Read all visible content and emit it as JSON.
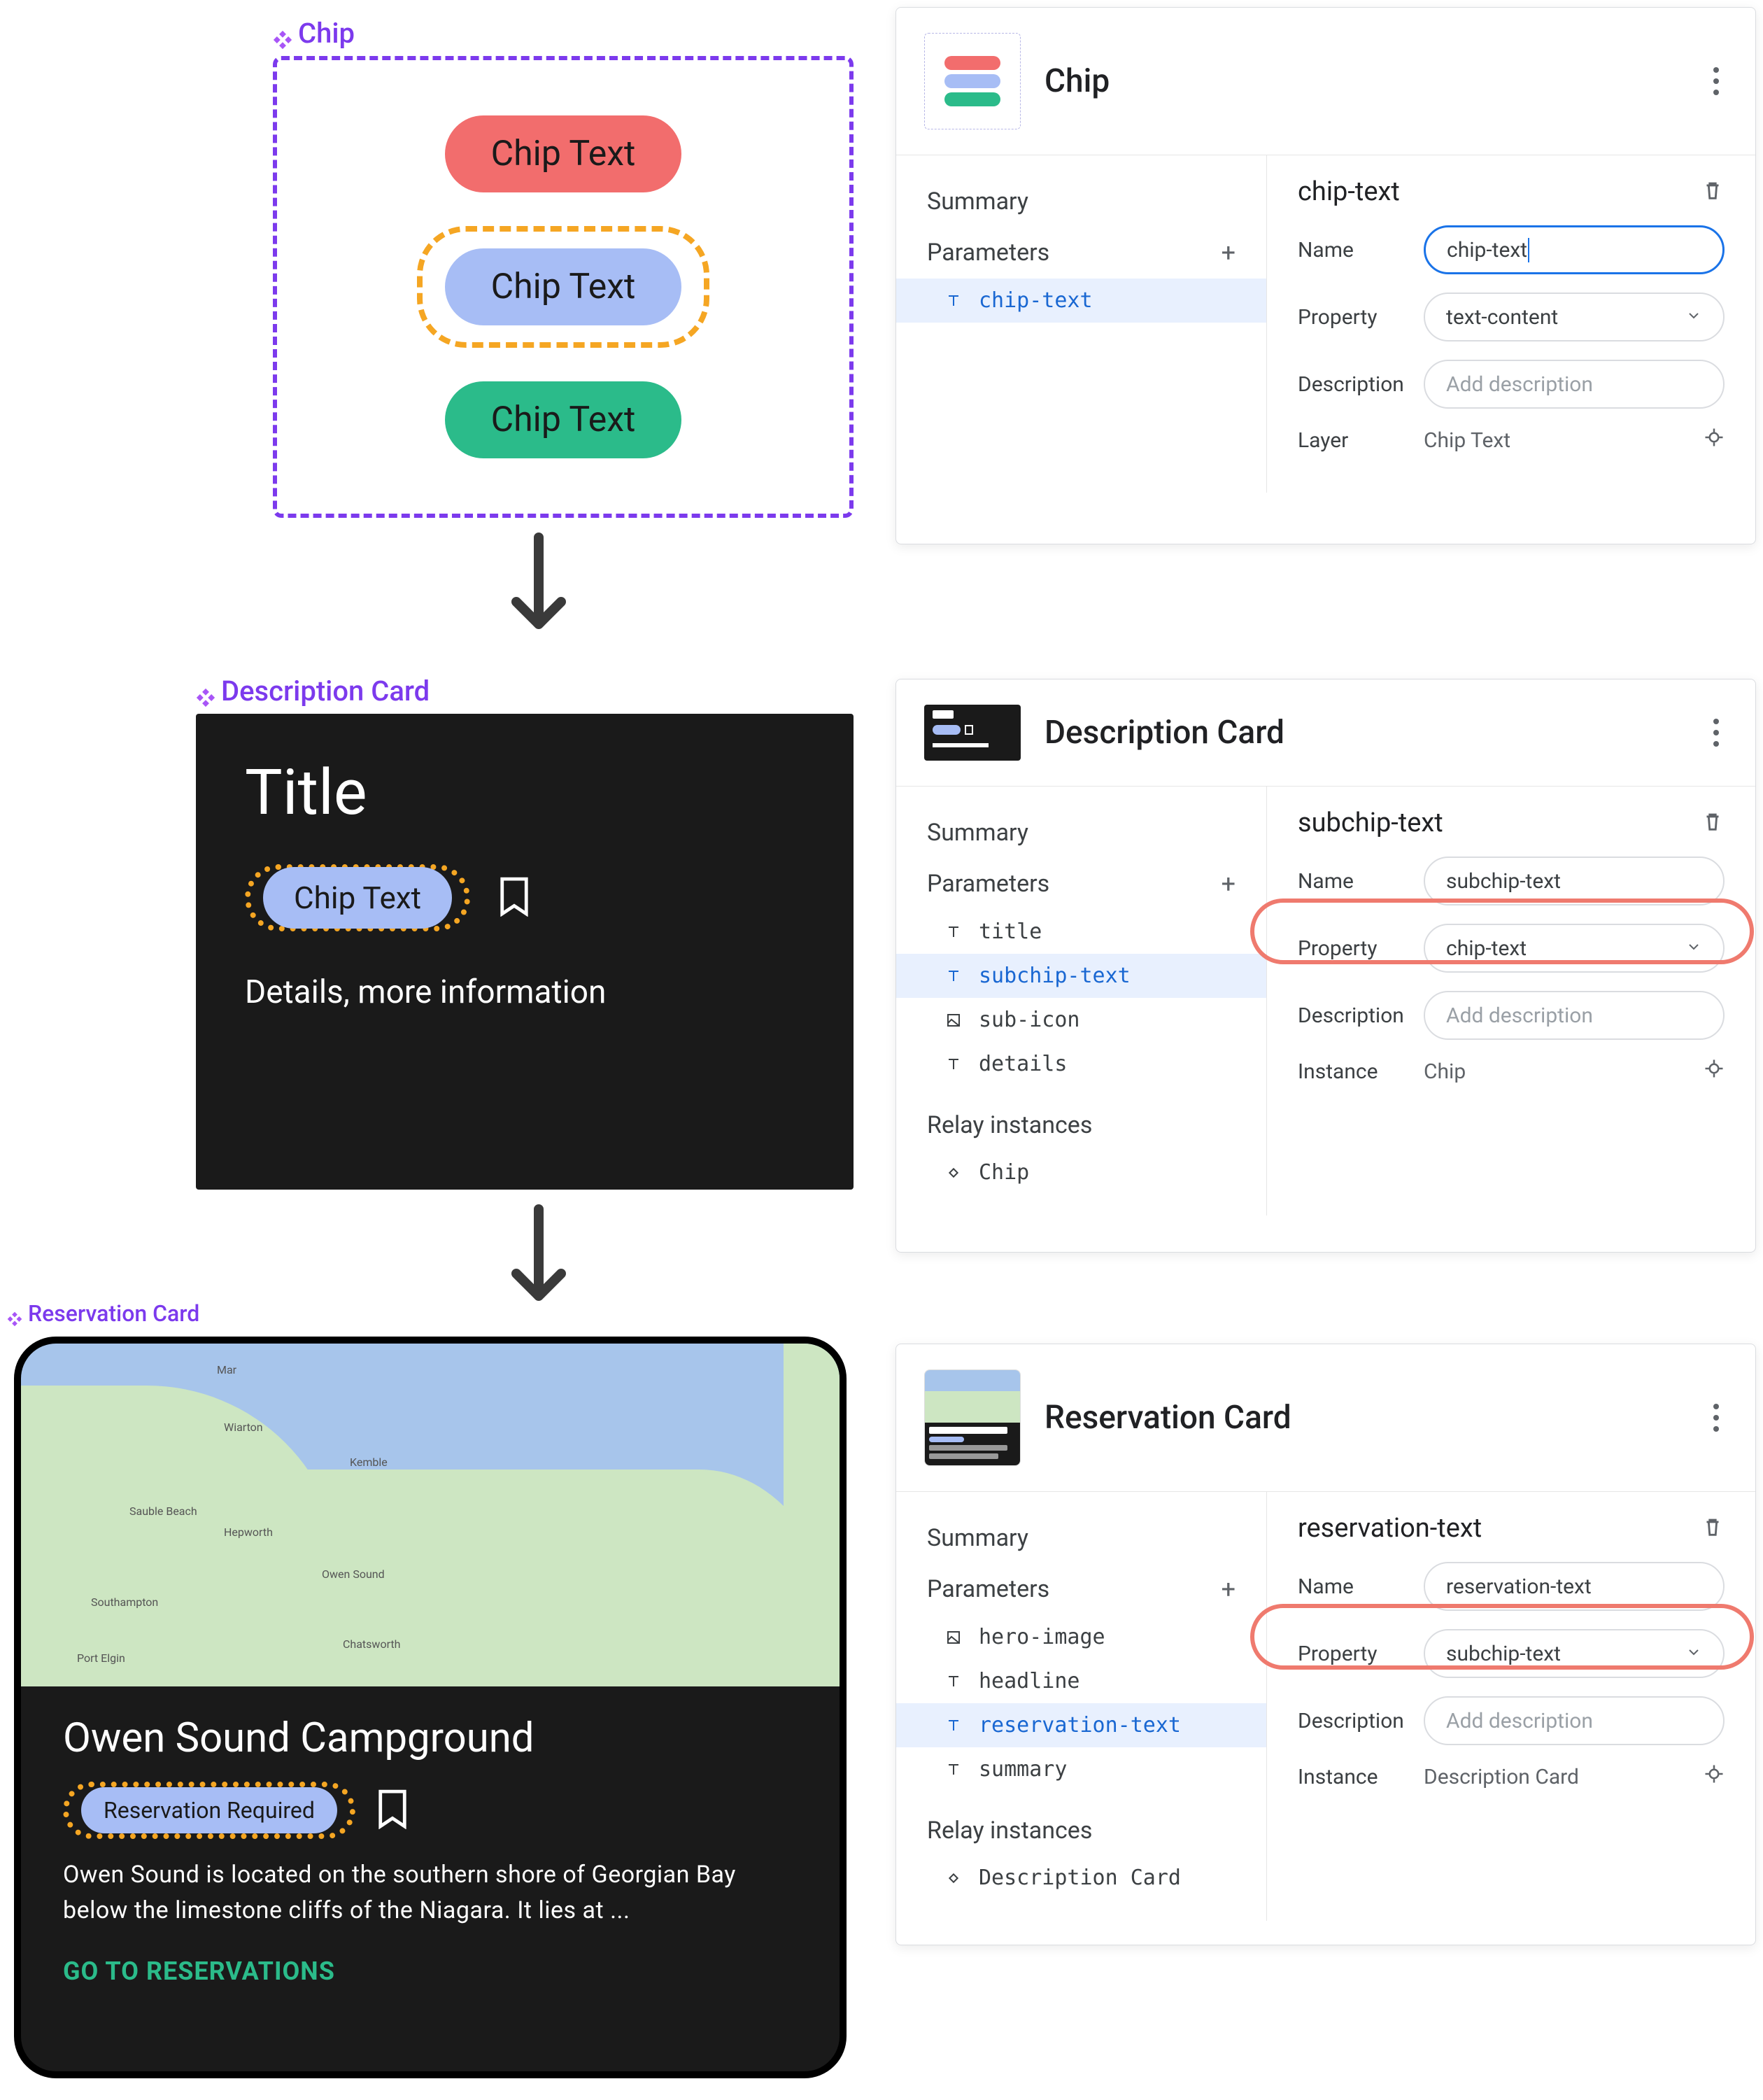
{
  "labels": {
    "chip": "Chip",
    "description_card": "Description Card",
    "reservation_card": "Reservation Card"
  },
  "chip_preview": {
    "chips": [
      "Chip Text",
      "Chip Text",
      "Chip Text"
    ]
  },
  "description_preview": {
    "title": "Title",
    "chip_text": "Chip Text",
    "details": "Details, more information"
  },
  "reservation_preview": {
    "map_places": [
      "Wiarton",
      "Kemble",
      "Sauble Beach",
      "Hepworth",
      "Owen Sound",
      "Southampton",
      "Chatsworth",
      "Port Elgin",
      "Mar"
    ],
    "headline": "Owen Sound Campground",
    "chip_text": "Reservation Required",
    "summary": "Owen Sound is located on the southern shore of Georgian Bay below the limestone cliffs of the Niagara. It lies at ...",
    "action": "GO TO RESERVATIONS"
  },
  "panel_chip": {
    "title": "Chip",
    "summary_label": "Summary",
    "parameters_label": "Parameters",
    "params": [
      {
        "icon": "T",
        "name": "chip-text",
        "selected": true
      }
    ],
    "detail": {
      "title": "chip-text",
      "name_label": "Name",
      "name_value": "chip-text",
      "property_label": "Property",
      "property_value": "text-content",
      "desc_label": "Description",
      "desc_placeholder": "Add description",
      "layer_label": "Layer",
      "layer_value": "Chip Text"
    }
  },
  "panel_desc": {
    "title": "Description Card",
    "summary_label": "Summary",
    "parameters_label": "Parameters",
    "relay_label": "Relay instances",
    "params": [
      {
        "icon": "T",
        "name": "title"
      },
      {
        "icon": "T",
        "name": "subchip-text",
        "selected": true
      },
      {
        "icon": "I",
        "name": "sub-icon"
      },
      {
        "icon": "T",
        "name": "details"
      }
    ],
    "relay": [
      {
        "icon": "D",
        "name": "Chip"
      }
    ],
    "detail": {
      "title": "subchip-text",
      "name_label": "Name",
      "name_value": "subchip-text",
      "property_label": "Property",
      "property_value": "chip-text",
      "desc_label": "Description",
      "desc_placeholder": "Add description",
      "instance_label": "Instance",
      "instance_value": "Chip"
    }
  },
  "panel_res": {
    "title": "Reservation Card",
    "summary_label": "Summary",
    "parameters_label": "Parameters",
    "relay_label": "Relay instances",
    "params": [
      {
        "icon": "I",
        "name": "hero-image"
      },
      {
        "icon": "T",
        "name": "headline"
      },
      {
        "icon": "T",
        "name": "reservation-text",
        "selected": true
      },
      {
        "icon": "T",
        "name": "summary"
      }
    ],
    "relay": [
      {
        "icon": "D",
        "name": "Description Card"
      }
    ],
    "detail": {
      "title": "reservation-text",
      "name_label": "Name",
      "name_value": "reservation-text",
      "property_label": "Property",
      "property_value": "subchip-text",
      "desc_label": "Description",
      "desc_placeholder": "Add description",
      "instance_label": "Instance",
      "instance_value": "Description Card"
    }
  }
}
